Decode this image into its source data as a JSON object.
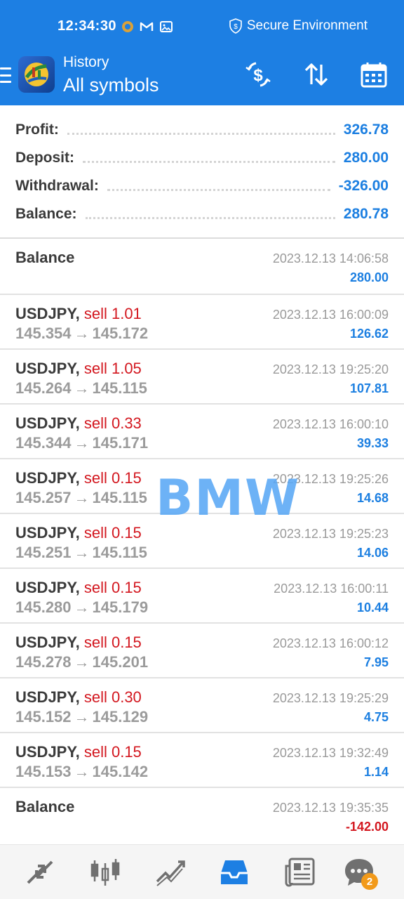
{
  "status_bar": {
    "time": "12:34:30",
    "secure_label": "Secure Environment",
    "icons": [
      "notification-icon",
      "gmail-icon",
      "photo-icon",
      "shield-dollar-icon"
    ]
  },
  "app_bar": {
    "subtitle": "History",
    "title": "All symbols",
    "actions": [
      "currency-filter-icon",
      "sort-icon",
      "calendar-icon"
    ]
  },
  "summary": [
    {
      "label": "Profit:",
      "value": "326.78"
    },
    {
      "label": "Deposit:",
      "value": "280.00"
    },
    {
      "label": "Withdrawal:",
      "value": "-326.00"
    },
    {
      "label": "Balance:",
      "value": "280.78"
    }
  ],
  "deals": [
    {
      "symbol": "Balance",
      "type": "",
      "open": "",
      "close": "",
      "time": "2023.12.13 14:06:58",
      "profit": "280.00"
    },
    {
      "symbol": "USDJPY,",
      "type": "sell 1.01",
      "open": "145.354",
      "close": "145.172",
      "time": "2023.12.13 16:00:09",
      "profit": "126.62"
    },
    {
      "symbol": "USDJPY,",
      "type": "sell 1.05",
      "open": "145.264",
      "close": "145.115",
      "time": "2023.12.13 19:25:20",
      "profit": "107.81"
    },
    {
      "symbol": "USDJPY,",
      "type": "sell 0.33",
      "open": "145.344",
      "close": "145.171",
      "time": "2023.12.13 16:00:10",
      "profit": "39.33"
    },
    {
      "symbol": "USDJPY,",
      "type": "sell 0.15",
      "open": "145.257",
      "close": "145.115",
      "time": "2023.12.13 19:25:26",
      "profit": "14.68"
    },
    {
      "symbol": "USDJPY,",
      "type": "sell 0.15",
      "open": "145.251",
      "close": "145.115",
      "time": "2023.12.13 19:25:23",
      "profit": "14.06"
    },
    {
      "symbol": "USDJPY,",
      "type": "sell 0.15",
      "open": "145.280",
      "close": "145.179",
      "time": "2023.12.13 16:00:11",
      "profit": "10.44"
    },
    {
      "symbol": "USDJPY,",
      "type": "sell 0.15",
      "open": "145.278",
      "close": "145.201",
      "time": "2023.12.13 16:00:12",
      "profit": "7.95"
    },
    {
      "symbol": "USDJPY,",
      "type": "sell 0.30",
      "open": "145.152",
      "close": "145.129",
      "time": "2023.12.13 19:25:29",
      "profit": "4.75"
    },
    {
      "symbol": "USDJPY,",
      "type": "sell 0.15",
      "open": "145.153",
      "close": "145.142",
      "time": "2023.12.13 19:32:49",
      "profit": "1.14"
    },
    {
      "symbol": "Balance",
      "type": "",
      "open": "",
      "close": "",
      "time": "2023.12.13 19:35:35",
      "profit": "-142.00"
    }
  ],
  "arrow_symbol": "→",
  "watermark": "BMW",
  "bottom_nav": {
    "items": [
      "trade-icon",
      "quotes-chart-icon",
      "chart-icon",
      "history-inbox-icon",
      "news-icon",
      "chat-icon"
    ],
    "chat_badge": "2"
  },
  "colors": {
    "primary": "#1d7fe3",
    "value_blue": "#1c7fe1",
    "sell_red": "#d3171f",
    "active_nav": "#1d7fe3",
    "badge": "#f29a1a"
  }
}
